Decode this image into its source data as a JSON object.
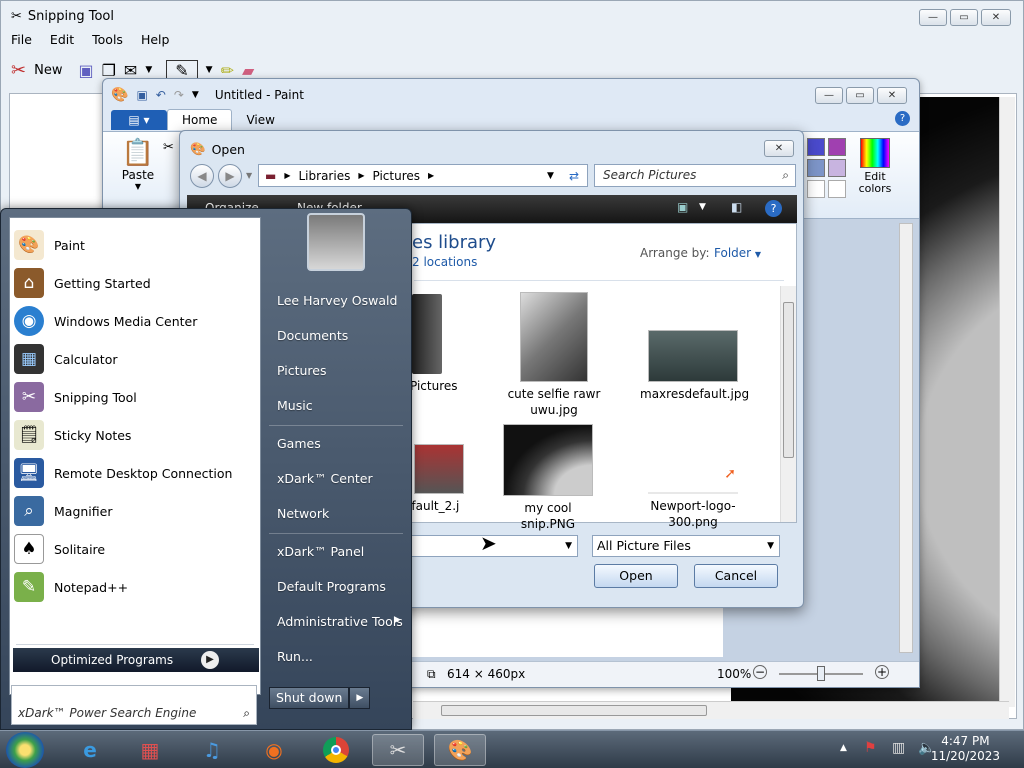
{
  "snipping": {
    "title": "Snipping Tool",
    "menu": [
      "File",
      "Edit",
      "Tools",
      "Help"
    ],
    "new_label": "New"
  },
  "paint": {
    "title": "Untitled - Paint",
    "tabs": [
      "Home",
      "View"
    ],
    "paste_label": "Paste",
    "edit_colors_line1": "Edit",
    "edit_colors_line2": "colors",
    "palette": [
      "#4a4acc",
      "#a040b0",
      "#7d95c8",
      "#c8b4e0",
      "#ffffff",
      "#ffffff"
    ],
    "status_size": "614 × 460px",
    "zoom": "100%"
  },
  "open_dialog": {
    "title": "Open",
    "breadcrumb": [
      "Libraries",
      "Pictures"
    ],
    "search_placeholder": "Search Pictures",
    "organize_label": "Organize",
    "new_folder_label": "New folder",
    "library_title": "es library",
    "locations": "2 locations",
    "arrange_by_label": "Arrange by:",
    "arrange_by_value": "Folder",
    "files": [
      {
        "label": "Pictures"
      },
      {
        "label": "cute selfie rawr uwu.jpg"
      },
      {
        "label": "maxresdefault.jpg"
      },
      {
        "label": "efault_2.j"
      },
      {
        "label": "my cool snip.PNG"
      },
      {
        "label": "Newport-logo-300.png"
      }
    ],
    "file_type": "All Picture Files",
    "open_label": "Open",
    "cancel_label": "Cancel"
  },
  "start_menu": {
    "programs": [
      {
        "label": "Paint",
        "icon": "paint-icon"
      },
      {
        "label": "Getting Started",
        "icon": "birdhouse-icon"
      },
      {
        "label": "Windows Media Center",
        "icon": "media-center-icon"
      },
      {
        "label": "Calculator",
        "icon": "calculator-icon"
      },
      {
        "label": "Snipping Tool",
        "icon": "snipping-icon"
      },
      {
        "label": "Sticky Notes",
        "icon": "sticky-notes-icon"
      },
      {
        "label": "Remote Desktop Connection",
        "icon": "remote-desktop-icon"
      },
      {
        "label": "Magnifier",
        "icon": "magnifier-icon"
      },
      {
        "label": "Solitaire",
        "icon": "cards-icon"
      },
      {
        "label": "Notepad++",
        "icon": "notepad-icon"
      }
    ],
    "optimized_label": "Optimized Programs",
    "search_placeholder": "xDark™ Power Search Engine",
    "right_items": [
      "Lee Harvey Oswald",
      "Documents",
      "Pictures",
      "Music",
      "Games",
      "xDark™ Center",
      "Network",
      "xDark™ Panel",
      "Default Programs",
      "Administrative Tools",
      "Run..."
    ],
    "shutdown_label": "Shut down"
  },
  "taskbar": {
    "time": "4:47 PM",
    "date": "11/20/2023"
  }
}
